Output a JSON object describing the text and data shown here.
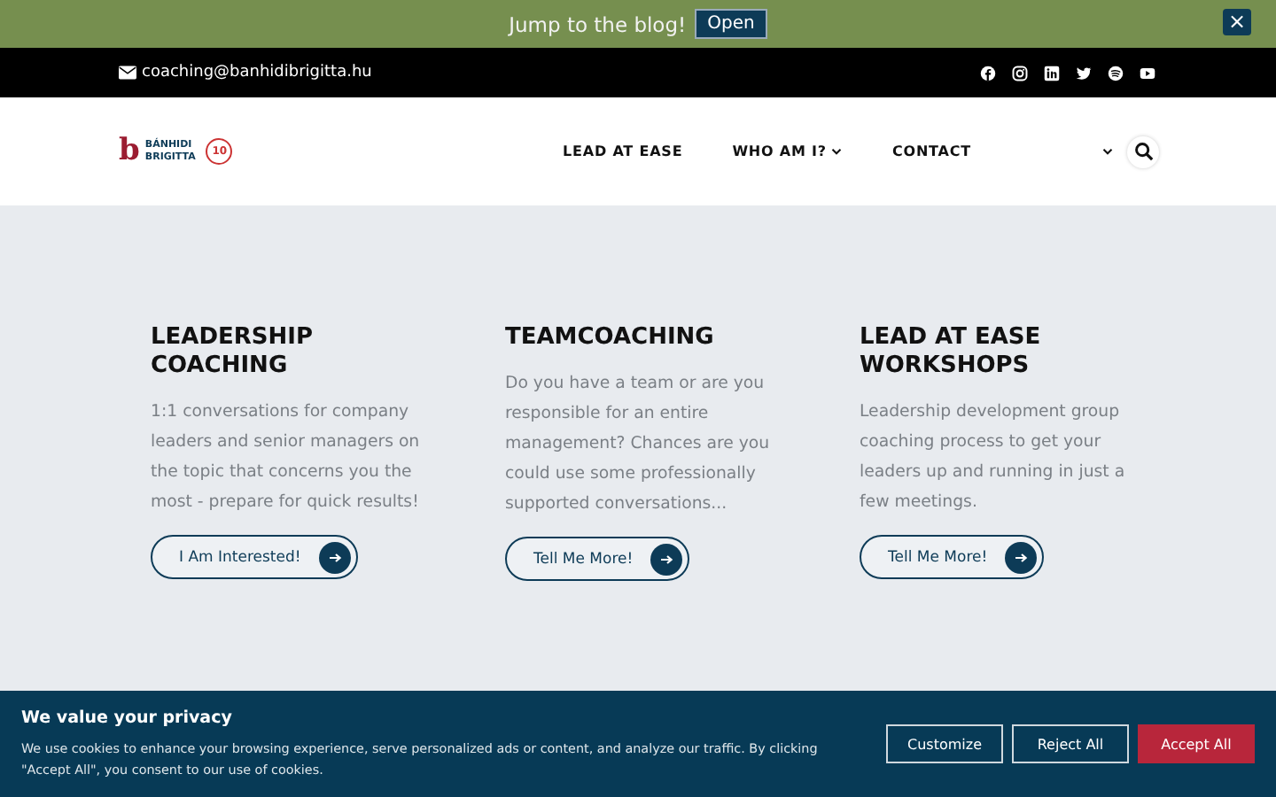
{
  "announcement": {
    "text": "Jump to the blog!",
    "button": "Open",
    "close": "×"
  },
  "topbar": {
    "email": "coaching@banhidibrigitta.hu"
  },
  "header": {
    "logo": {
      "mark": "b",
      "name": "BÁNHIDI",
      "surname": "BRIGITTA",
      "badge": "10"
    },
    "nav": [
      {
        "label": "LEAD AT EASE",
        "dropdown": false
      },
      {
        "label": "WHO AM I?",
        "dropdown": true
      },
      {
        "label": "CONTACT",
        "dropdown": false
      }
    ]
  },
  "cards": [
    {
      "title": "LEADERSHIP COACHING",
      "text": "1:1 conversations for company leaders and senior managers on the topic that concerns you the most - prepare for quick results!",
      "button": "I Am Interested!"
    },
    {
      "title": "TEAMCOACHING",
      "text": "Do you have a team or are you responsible for an entire management? Chances are you could use some professionally supported conversations...",
      "button": "Tell Me More!"
    },
    {
      "title": "LEAD AT EASE WORKSHOPS",
      "text": "Leadership development group coaching process to get your leaders up and running in just a few meetings.",
      "button": "Tell Me More!"
    }
  ],
  "cookie": {
    "title": "We value your privacy",
    "text": "We use cookies to enhance your browsing experience, serve personalized ads or content, and analyze our traffic. By clicking \"Accept All\", you consent to our use of cookies.",
    "buttons": [
      {
        "label": "Customize",
        "kind": "outline"
      },
      {
        "label": "Reject All",
        "kind": "outline"
      },
      {
        "label": "Accept All",
        "kind": "primary"
      }
    ]
  }
}
